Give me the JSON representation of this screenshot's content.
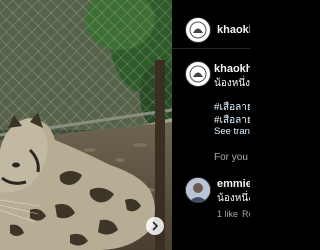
{
  "post_header": {
    "username": "khaokh"
  },
  "caption": {
    "username": "khaokh",
    "text": "น้องหนึ่ง",
    "hashtags": [
      "#เสือลาย",
      "#เสือลาย"
    ],
    "see_translation": "See tran"
  },
  "for_you": "For you",
  "comment": {
    "username": "emmie",
    "text": "น้องหนึ่ง",
    "likes": "1 like",
    "reply": "Rep"
  },
  "colors": {
    "accent_link": "#e0f1ff",
    "secondary_text": "#a8a8a8",
    "background": "#000000"
  },
  "icons": {
    "next": "chevron-right-icon"
  }
}
